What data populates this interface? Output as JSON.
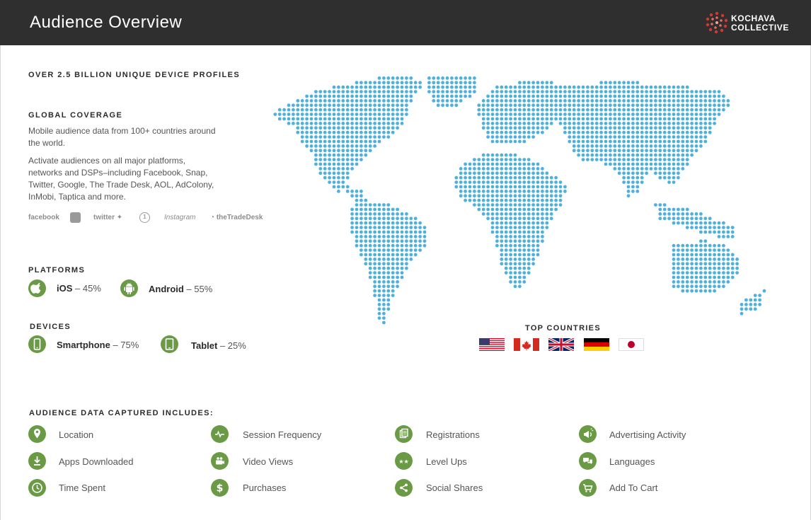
{
  "header": {
    "title": "Audience Overview",
    "logo_line1": "KOCHAVA",
    "logo_line2": "COLLECTIVE"
  },
  "intro": {
    "headline": "OVER 2.5 BILLION UNIQUE DEVICE PROFILES"
  },
  "coverage": {
    "heading": "GLOBAL COVERAGE",
    "para1": "Mobile audience data from 100+ countries around the world.",
    "para2": "Activate audiences on all major platforms, networks and DSPs–including Facebook, Snap, Twitter, Google, The Trade Desk, AOL, AdColony, InMobi, Taptica and more.",
    "partners": [
      "facebook",
      "twitter",
      "Instagram",
      "theTradeDesk"
    ]
  },
  "platforms": {
    "heading": "PLATFORMS",
    "items": [
      {
        "name": "iOS",
        "value": "– 45%",
        "icon": "apple-icon"
      },
      {
        "name": "Android",
        "value": "– 55%",
        "icon": "android-icon"
      }
    ]
  },
  "devices": {
    "heading": "DEVICES",
    "items": [
      {
        "name": "Smartphone",
        "value": "– 75%",
        "icon": "smartphone-icon"
      },
      {
        "name": "Tablet",
        "value": "– 25%",
        "icon": "tablet-icon"
      }
    ]
  },
  "top_countries": {
    "heading": "TOP COUNTRIES",
    "flags": [
      "us-flag-icon",
      "canada-flag-icon",
      "uk-flag-icon",
      "germany-flag-icon",
      "japan-flag-icon"
    ]
  },
  "audience_data": {
    "heading": "AUDIENCE DATA CAPTURED INCLUDES:",
    "items": [
      {
        "label": "Location",
        "icon": "location-pin-icon"
      },
      {
        "label": "Session Frequency",
        "icon": "pulse-icon"
      },
      {
        "label": "Registrations",
        "icon": "registration-icon"
      },
      {
        "label": "Advertising Activity",
        "icon": "megaphone-icon"
      },
      {
        "label": "Apps Downloaded",
        "icon": "download-icon"
      },
      {
        "label": "Video Views",
        "icon": "video-camera-icon"
      },
      {
        "label": "Level Ups",
        "icon": "stars-icon"
      },
      {
        "label": "Languages",
        "icon": "speech-bubbles-icon"
      },
      {
        "label": "Time Spent",
        "icon": "clock-icon"
      },
      {
        "label": "Purchases",
        "icon": "dollar-icon"
      },
      {
        "label": "Social Shares",
        "icon": "share-icon"
      },
      {
        "label": "Add To Cart",
        "icon": "cart-icon"
      }
    ]
  },
  "colors": {
    "header_bg": "#2f2f2f",
    "accent_green": "#6a9a45",
    "map_dot": "#4fb0dd"
  }
}
